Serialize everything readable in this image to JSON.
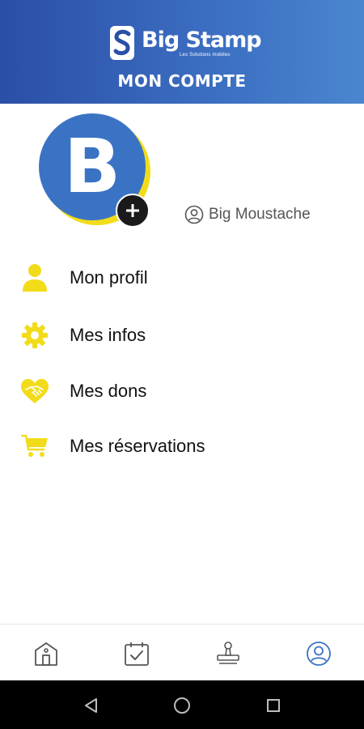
{
  "header": {
    "logo": {
      "name": "Big Stamp",
      "tagline": "Les Solutions mobiles",
      "icon": "big-stamp-logo-icon"
    },
    "title": "MON COMPTE"
  },
  "profile": {
    "avatar_letter": "B",
    "add_icon": "plus-icon",
    "username": "Big Moustache",
    "username_icon": "user-circle-icon"
  },
  "menu": {
    "items": [
      {
        "label": "Mon profil",
        "icon": "person-icon"
      },
      {
        "label": "Mes infos",
        "icon": "gear-icon"
      },
      {
        "label": "Mes dons",
        "icon": "handshake-heart-icon"
      },
      {
        "label": "Mes réservations",
        "icon": "cart-icon"
      }
    ]
  },
  "bottom_nav": {
    "items": [
      {
        "icon": "home-icon",
        "active": false
      },
      {
        "icon": "calendar-check-icon",
        "active": false
      },
      {
        "icon": "stamp-icon",
        "active": false
      },
      {
        "icon": "account-icon",
        "active": true
      }
    ]
  },
  "system_nav": {
    "buttons": [
      "back-icon",
      "home-circle-icon",
      "recents-icon"
    ]
  },
  "colors": {
    "header_start": "#2a4fa6",
    "header_end": "#4a86cf",
    "accent_yellow": "#f2dc1a",
    "avatar_blue": "#3b73c4",
    "active_nav": "#3b73c4",
    "inactive_nav": "#555555"
  }
}
